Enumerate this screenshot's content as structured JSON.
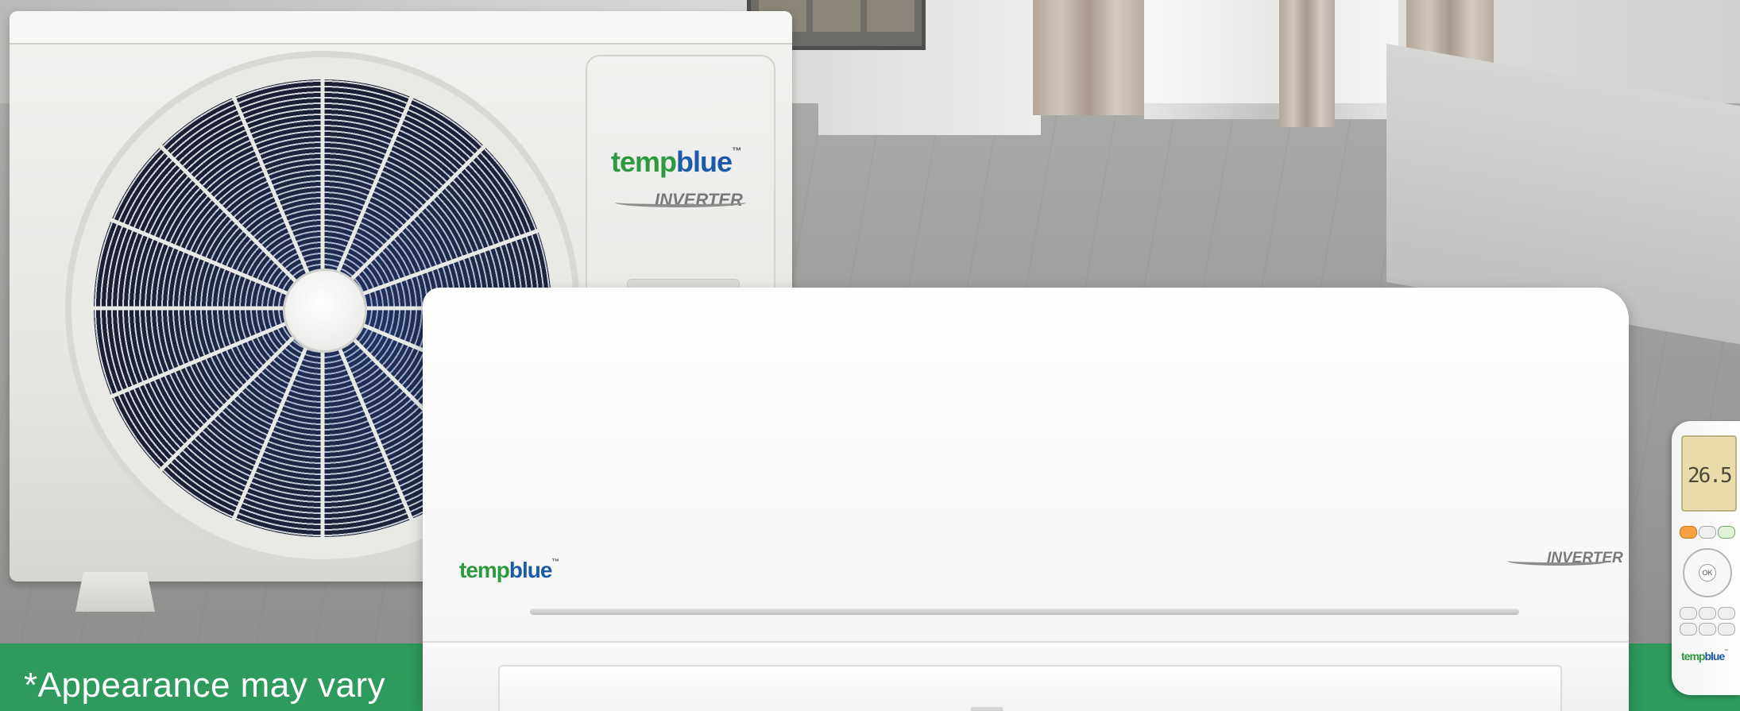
{
  "disclaimer": "*Appearance may vary",
  "outdoor_unit": {
    "brand_temp": "temp",
    "brand_blue": "blue",
    "brand_tm": "™",
    "badge": "INVERTER"
  },
  "indoor_unit": {
    "brand_temp": "temp",
    "brand_blue": "blue",
    "brand_tm": "™",
    "badge": "INVERTER"
  },
  "remote": {
    "display": "26.5",
    "ok_label": "OK",
    "brand_temp": "temp",
    "brand_blue": "blue",
    "brand_tm": "™"
  },
  "colors": {
    "band_green": "#2e9a5c",
    "brand_green": "#2e9a3f",
    "brand_blue": "#1d5aa8"
  }
}
